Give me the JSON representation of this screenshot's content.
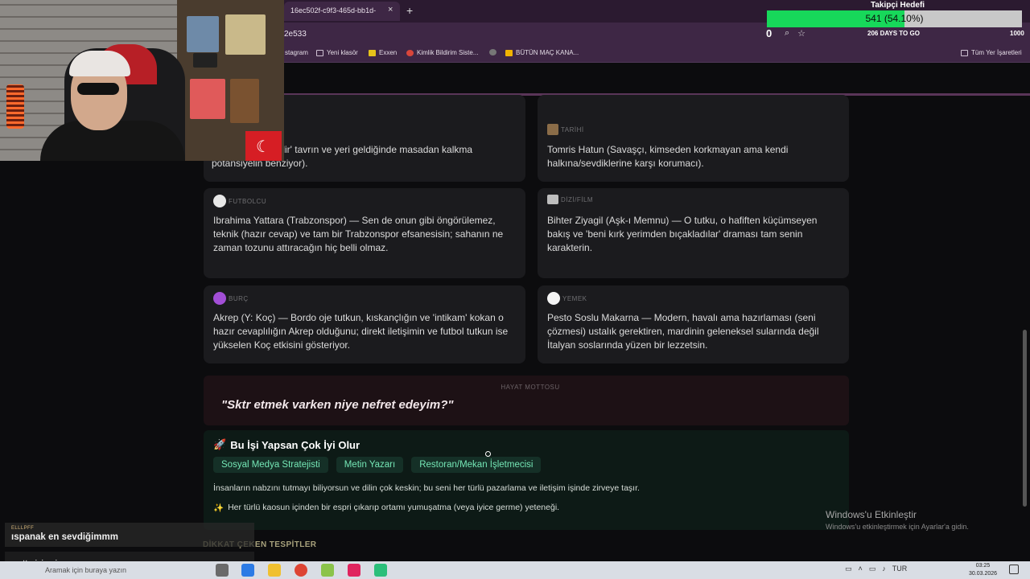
{
  "browser": {
    "tab_title": "16ec502f-c9f3-465d-bb1d-",
    "tab_close": "×",
    "tab_new": "+",
    "url_fragment": "2e533",
    "bookmarks": [
      {
        "label": "stagram"
      },
      {
        "label": "Yeni klasör"
      },
      {
        "label": "Exxen"
      },
      {
        "label": "Kimlik Bildirim Siste..."
      },
      {
        "label": ""
      },
      {
        "label": "BÜTÜN MAÇ KANA..."
      }
    ],
    "all_bookmarks": "Tüm Yer İşaretleri"
  },
  "overlay": {
    "goal_title": "Takipçi Hedefi",
    "goal_text": "541 (54.10%)",
    "goal_fraction": 0.541,
    "counter": "0",
    "days_text": "206 DAYS TO GO",
    "target": "1000"
  },
  "cards": [
    {
      "category": "",
      "text": "(O 'valla kendi bilir' tavrın ve yeri geldiğinde masadan kalkma potansiyelin benziyor)."
    },
    {
      "category": "TARİHİ",
      "text": "Tomris Hatun (Savaşçı, kimseden korkmayan ama kendi halkına/sevdiklerine karşı korumacı)."
    },
    {
      "category": "FUTBOLCU",
      "text": "Ibrahima Yattara (Trabzonspor) — Sen de onun gibi öngörülemez, teknik (hazır cevap) ve tam bir Trabzonspor efsanesisin; sahanın ne zaman tozunu attıracağın hiç belli olmaz."
    },
    {
      "category": "DİZİ/FİLM",
      "text": "Bihter Ziyagil (Aşk-ı Memnu) — O tutku, o hafiften küçümseyen bakış ve 'beni kırk yerimden bıçakladılar' draması tam senin karakterin."
    },
    {
      "category": "BURÇ",
      "text": "Akrep (Y: Koç) — Bordo oje tutkun, kıskançlığın ve 'intikam' kokan o hazır cevaplılığın Akrep olduğunu; direkt iletişimin ve futbol tutkun ise yükselen Koç etkisini gösteriyor."
    },
    {
      "category": "YEMEK",
      "text": "Pesto Soslu Makarna — Modern, havalı ama hazırlaması (seni çözmesi) ustalık gerektiren, mardinin geleneksel sularında değil İtalyan soslarında yüzen bir lezzetsin."
    }
  ],
  "motto": {
    "label": "HAYAT MOTTOSU",
    "text": "\"Sktr etmek varken niye nefret edeyim?\""
  },
  "jobs": {
    "icon": "🚀",
    "title": "Bu İşi Yapsan Çok İyi Olur",
    "tags": [
      "Sosyal Medya Stratejisti",
      "Metin Yazarı",
      "Restoran/Mekan İşletmecisi"
    ],
    "description": "İnsanların nabzını tutmayı biliyorsun ve dilin çok keskin; bu seni her türlü pazarlama ve iletişim işinde zirveye taşır.",
    "extra_icon": "✨",
    "extra": "Her türlü kaosun içinden bir espri çıkarıp ortamı yumuşatma (veya iyice germe) yeteneği."
  },
  "section_head": "DİKKAT ÇEKEN TESPİTLER",
  "chat": {
    "user1": "ELLLPFF",
    "msg1": "ıspanak en sevdiğimmm",
    "user2": "",
    "msg2": "motto iyiymi"
  },
  "windows": {
    "activate_title": "Windows'u Etkinleştir",
    "activate_sub": "Windows'u etkinleştirmek için Ayarlar'a gidin.",
    "search_placeholder": "Aramak için buraya yazın",
    "lang": "TUR",
    "time": "03:25",
    "date": "30.03.2026"
  },
  "colors": {
    "goal_fill": "#17d85a",
    "tag_text": "#75e7b6",
    "browser_bg": "#3e2745"
  }
}
